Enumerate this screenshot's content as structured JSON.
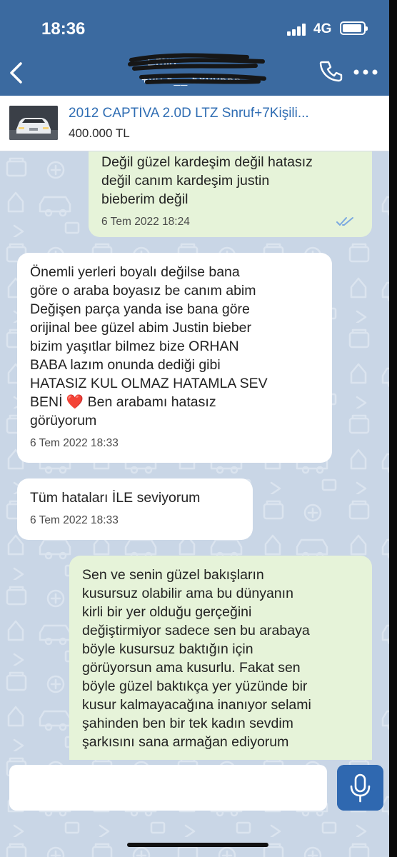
{
  "status_bar": {
    "time": "18:36",
    "network": "4G"
  },
  "header": {
    "contact_name": "Emin",
    "contact_number": "+90 5__ 5899556",
    "back_icon": "chevron-left-icon",
    "call_icon": "phone-icon",
    "more_icon": "more-horizontal-icon"
  },
  "listing": {
    "title": "2012 CAPTİVA 2.0D LTZ Snruf+7Kişili...",
    "price": "400.000 TL"
  },
  "messages": [
    {
      "direction": "out",
      "text": "Değil güzel kardeşim değil hatasız\ndeğil canım kardeşim justin\nbieberim değil",
      "time": "6 Tem 2022 18:24",
      "read": true
    },
    {
      "direction": "in",
      "text": "Önemli yerleri boyalı değilse bana\ngöre o araba boyasız be canım abim\nDeğişen parça yanda ise bana göre\norijinal bee güzel abim Justin bieber\nbizim yaşıtlar bilmez bize ORHAN\nBABA lazım onunda dediği gibi\nHATASIZ KUL OLMAZ HATAMLA SEV\nBENİ ❤️ Ben arabamı hatasız\ngörüyorum",
      "time": "6 Tem 2022 18:33"
    },
    {
      "direction": "in",
      "text": "Tüm hataları İLE seviyorum",
      "time": "6 Tem 2022 18:33"
    },
    {
      "direction": "out",
      "text": "Sen ve senin güzel bakışların\nkusursuz olabilir ama bu dünyanın\nkirli bir yer olduğu gerçeğini\ndeğiştirmiyor sadece sen bu arabaya\nböyle kusursuz baktığın için\ngörüyorsun ama kusurlu. Fakat sen\nböyle güzel baktıkça yer yüzünde bir\nkusur kalmayacağına inanıyor selami\nşahinden ben bir tek kadın sevdim\nşarkısını sana armağan ediyorum",
      "time": ""
    }
  ],
  "composer": {
    "placeholder": "",
    "mic_icon": "microphone-icon"
  },
  "colors": {
    "header": "#3b6aa0",
    "outgoing_bubble": "#e6f3d9",
    "incoming_bubble": "#ffffff",
    "wallpaper": "#c9d6e6",
    "link": "#2f6db3"
  }
}
